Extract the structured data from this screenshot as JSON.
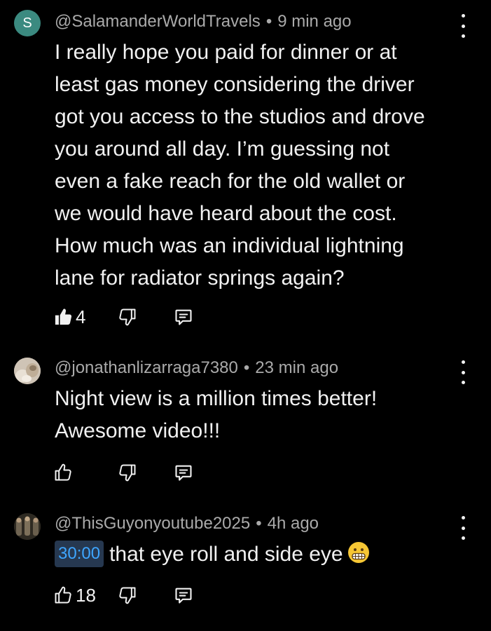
{
  "comments": [
    {
      "avatar_letter": "S",
      "avatar_color": "#3b8a80",
      "handle": "@SalamanderWorldTravels",
      "separator": "•",
      "time": "9 min ago",
      "lines": [
        "I really hope you paid for dinner or at",
        "least gas money considering the driver",
        "got you access to the studios and drove",
        "you around all day. I’m guessing not",
        "even a fake reach for the old wallet or",
        "we would have heard about the cost.",
        "How much was an individual lightning",
        "lane for radiator springs again?"
      ],
      "likes": "4",
      "liked": true
    },
    {
      "handle": "@jonathanlizarraga7380",
      "separator": "•",
      "time": "23 min ago",
      "lines": [
        "Night view is a million times better!",
        "Awesome video!!!"
      ],
      "likes": "",
      "liked": false
    },
    {
      "handle": "@ThisGuyonyoutube2025",
      "separator": "•",
      "time": "4h ago",
      "timestamp_link": "30:00",
      "text": "that eye roll and side eye",
      "emoji": "grimacing-face",
      "likes": "18",
      "liked": false
    }
  ]
}
